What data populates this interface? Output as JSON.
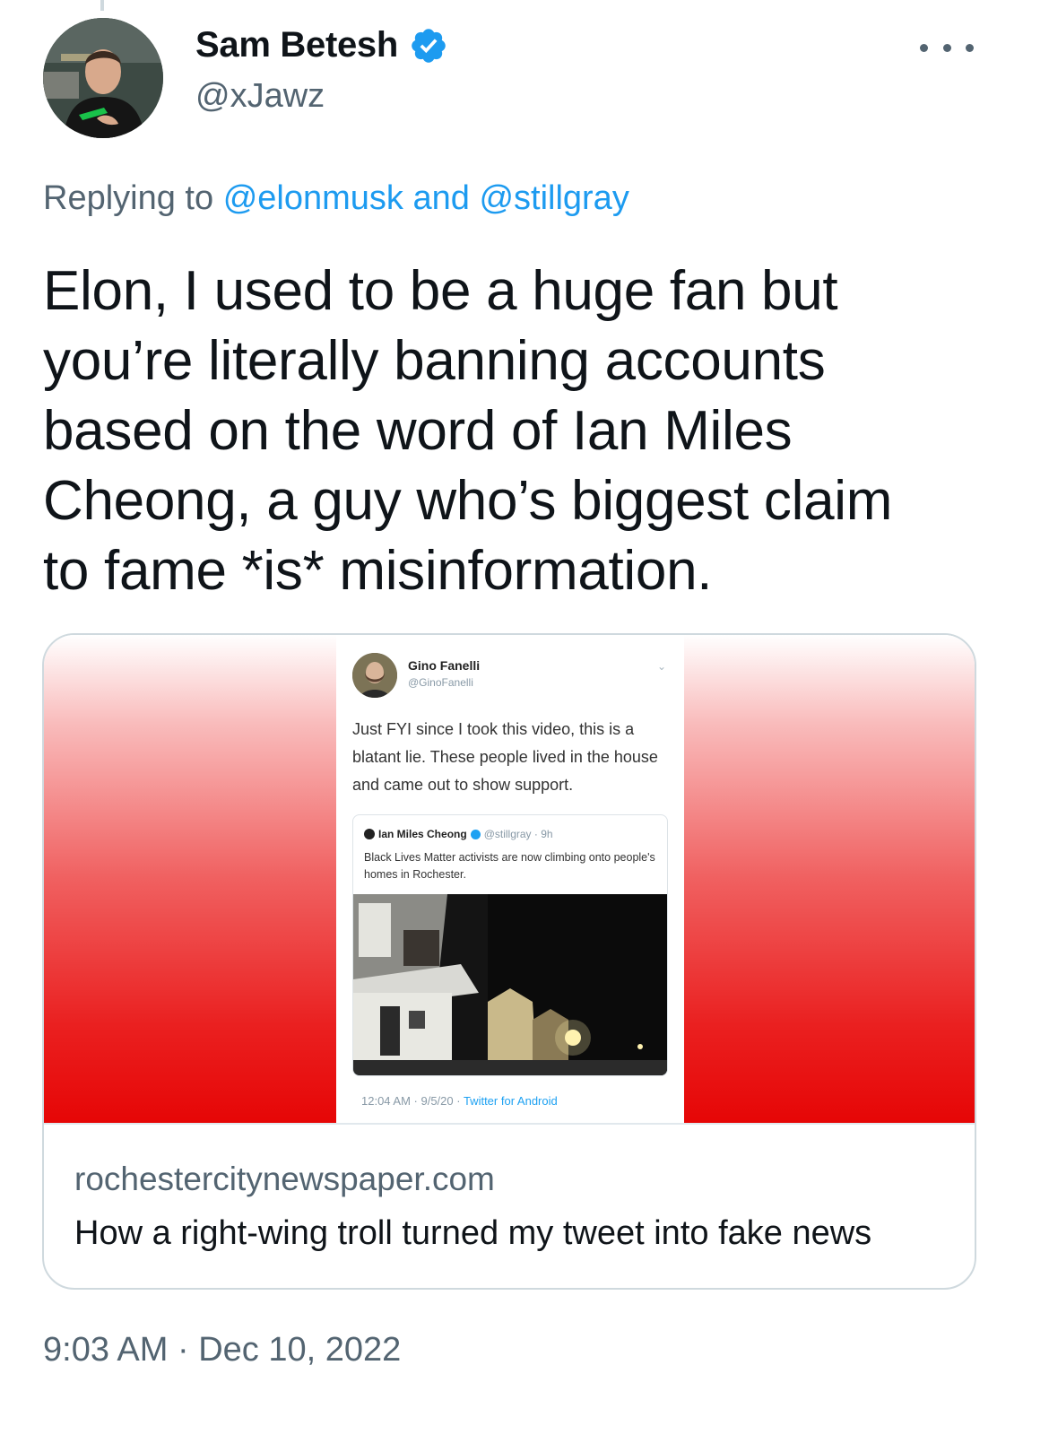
{
  "author": {
    "display_name": "Sam Betesh",
    "handle": "@xJawz",
    "verified": true,
    "avatar_icon": "profile-photo",
    "more_icon": "more-horizontal-icon"
  },
  "reply": {
    "prefix": "Replying to",
    "user1": "@elonmusk",
    "conjunction": "and",
    "user2": "@stillgray"
  },
  "tweet": {
    "text": "Elon, I used to be a huge fan but\nyou’re literally banning accounts\nbased on the word of Ian Miles\nCheong, a guy who’s biggest claim\nto fame *is* misinformation.",
    "timestamp": "9:03 AM · Dec 10, 2022"
  },
  "link_card": {
    "domain": "rochestercitynewspaper.com",
    "title": "How a right-wing troll turned my tweet into fake news",
    "gradient_colors": [
      "#ffffff",
      "#e60606"
    ],
    "embedded_tweet": {
      "name": "Gino Fanelli",
      "handle": "@GinoFanelli",
      "text": "Just FYI since I took this video, this is a blatant lie. These people lived in the house and came out to show support.",
      "quoted": {
        "name": "Ian Miles Cheong",
        "meta": "@stillgray · 9h",
        "text": "Black Lives Matter activists are now climbing onto people's homes in Rochester."
      },
      "meta_time": "12:04 AM · 9/5/20 · ",
      "meta_source": "Twitter for Android"
    }
  },
  "colors": {
    "accent": "#1d9bf0",
    "secondary_text": "#536471",
    "primary_text": "#0f1419"
  }
}
